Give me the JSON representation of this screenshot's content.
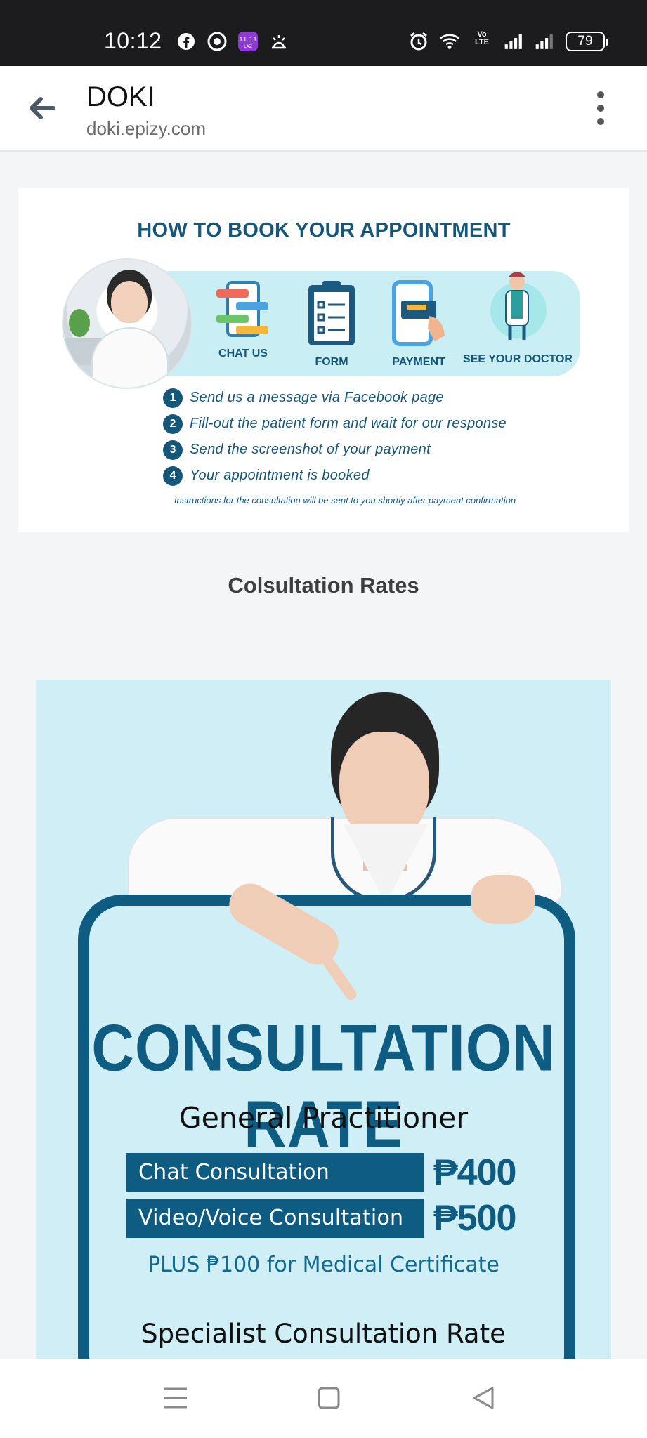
{
  "status_bar": {
    "time": "10:12",
    "battery": "79",
    "network_label": "Vo LTE"
  },
  "app_bar": {
    "title": "DOKI",
    "url": "doki.epizy.com"
  },
  "booking": {
    "title": "HOW TO BOOK YOUR APPOINTMENT",
    "icons": [
      "CHAT US",
      "FORM",
      "PAYMENT",
      "SEE YOUR DOCTOR"
    ],
    "steps": [
      {
        "num": "1",
        "text": "Send us a message via Facebook page"
      },
      {
        "num": "2",
        "text": "Fill-out the patient form and wait for our response"
      },
      {
        "num": "3",
        "text": "Send the screenshot of your payment"
      },
      {
        "num": "4",
        "text": "Your appointment is booked"
      }
    ],
    "note": "Instructions for the consultation will be sent to you shortly after payment confirmation"
  },
  "section_heading": "Colsultation Rates",
  "rates": {
    "title": "CONSULTATION RATE",
    "subtitle": "General Practitioner",
    "rows": [
      {
        "label": "Chat Consultation",
        "price": "₱400"
      },
      {
        "label": "Video/Voice Consultation",
        "price": "₱500"
      }
    ],
    "plus_note": "PLUS ₱100 for Medical Certificate",
    "specialist": "Specialist Consultation Rate"
  },
  "colors": {
    "brand_blue": "#0f5c82",
    "poster_bg": "#d0eef6",
    "banner_bg": "#c9eef4"
  },
  "icons": [
    "facebook-icon",
    "chrome-icon",
    "app-icon",
    "weather-icon",
    "alarm-icon",
    "wifi-icon",
    "signal-icon",
    "battery-icon",
    "back-arrow-icon",
    "more-vert-icon",
    "menu-icon",
    "home-icon",
    "back-icon"
  ]
}
